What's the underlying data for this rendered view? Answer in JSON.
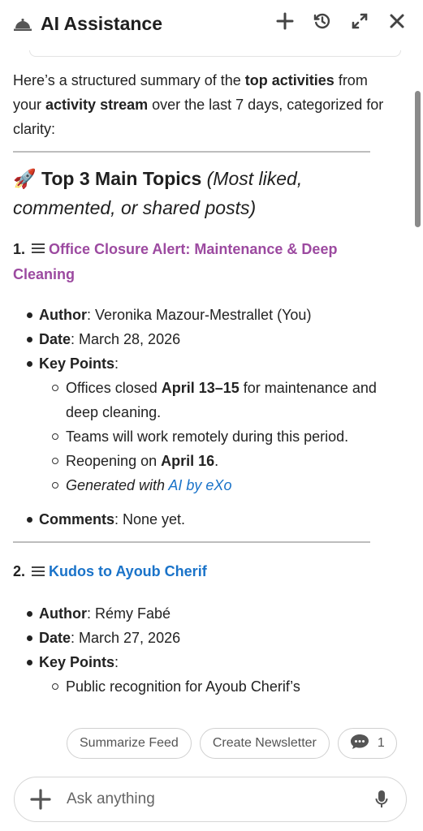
{
  "header": {
    "title": "AI Assistance",
    "icons": [
      "bell-logo-icon",
      "plus-icon",
      "history-icon",
      "expand-icon",
      "close-icon"
    ]
  },
  "content": {
    "intro": {
      "t1": "Here’s a structured summary of the ",
      "b1": "top activities",
      "t2": " from your ",
      "b2": "activity stream",
      "t3": " over the last 7 days, categorized for clarity:"
    },
    "section_title": {
      "emoji": "🚀",
      "strong": "Top 3 Main Topics",
      "em": "(Most liked, commented, or shared posts)"
    },
    "topics": [
      {
        "number": "1.",
        "title": "Office Closure Alert: Maintenance & Deep Cleaning",
        "author_label": "Author",
        "author": ": Veronika Mazour-Mestrallet (You)",
        "date_label": "Date",
        "date": ": March 28, 2026",
        "keypoints_label": "Key Points",
        "keypoints_suffix": ":",
        "kp1_pre": "Offices closed ",
        "kp1_bold": "April 13–15",
        "kp1_post": " for maintenance and deep cleaning.",
        "kp2": "Teams will work remotely during this period.",
        "kp3_pre": "Reopening on ",
        "kp3_bold": "April 16",
        "kp3_post": ".",
        "kp4_pre": "Generated with ",
        "kp4_link": "AI by eXo",
        "comments_label": "Comments",
        "comments": ": None yet."
      },
      {
        "number": "2.",
        "title": "Kudos to Ayoub Cherif",
        "author_label": "Author",
        "author": ": Rémy Fabé",
        "date_label": "Date",
        "date": ": March 27, 2026",
        "keypoints_label": "Key Points",
        "keypoints_suffix": ":",
        "kp1": "Public recognition for Ayoub Cherif’s"
      }
    ]
  },
  "chips": {
    "summarize": "Summarize Feed",
    "newsletter": "Create Newsletter",
    "comment_count": "1"
  },
  "input": {
    "placeholder": "Ask anything"
  },
  "colors": {
    "topic1_link": "#9c4aa0",
    "topic2_link": "#1a73c9",
    "ai_link": "#1a73c9"
  }
}
